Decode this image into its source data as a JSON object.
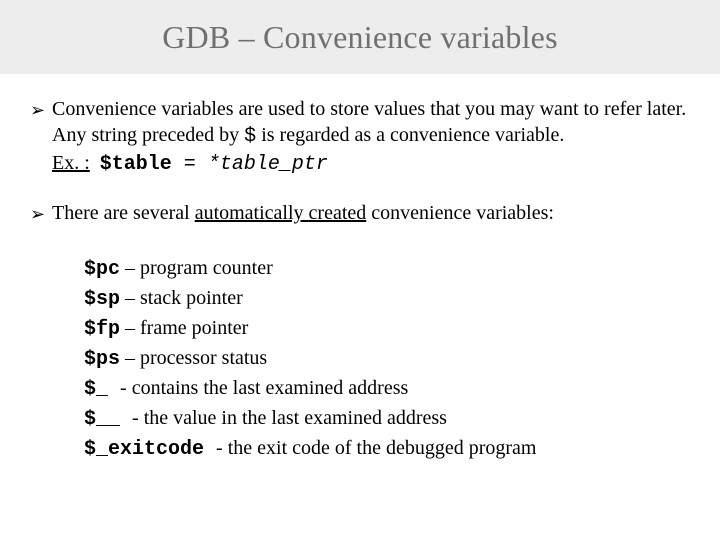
{
  "title": "GDB – Convenience variables",
  "bullets": {
    "b1": {
      "text": "Convenience variables are used to store values that you may want to refer later. Any string preceded by ",
      "dollar": "$",
      "text2": " is regarded as a convenience variable.",
      "ex_label": "Ex. :",
      "ex_code_b": "$table",
      "ex_code_eq": " = ",
      "ex_code_i": "*table_ptr"
    },
    "b2": {
      "text_a": "There are several ",
      "underlined": "automatically created",
      "text_b": " convenience variables:"
    }
  },
  "vars": [
    {
      "name": "$pc",
      "sep": " – ",
      "desc": "program counter"
    },
    {
      "name": "$sp",
      "sep": " – ",
      "desc": "stack pointer"
    },
    {
      "name": "$fp",
      "sep": " – ",
      "desc": "frame pointer"
    },
    {
      "name": "$ps",
      "sep": " – ",
      "desc": "processor status"
    },
    {
      "name": "$_ ",
      "sep": "- ",
      "desc": "contains the last examined address"
    },
    {
      "name": "$__ ",
      "sep": "- ",
      "desc": " the value in the last examined address"
    },
    {
      "name": "$_exitcode ",
      "sep": "- ",
      "desc": " the exit code of the debugged program"
    }
  ]
}
